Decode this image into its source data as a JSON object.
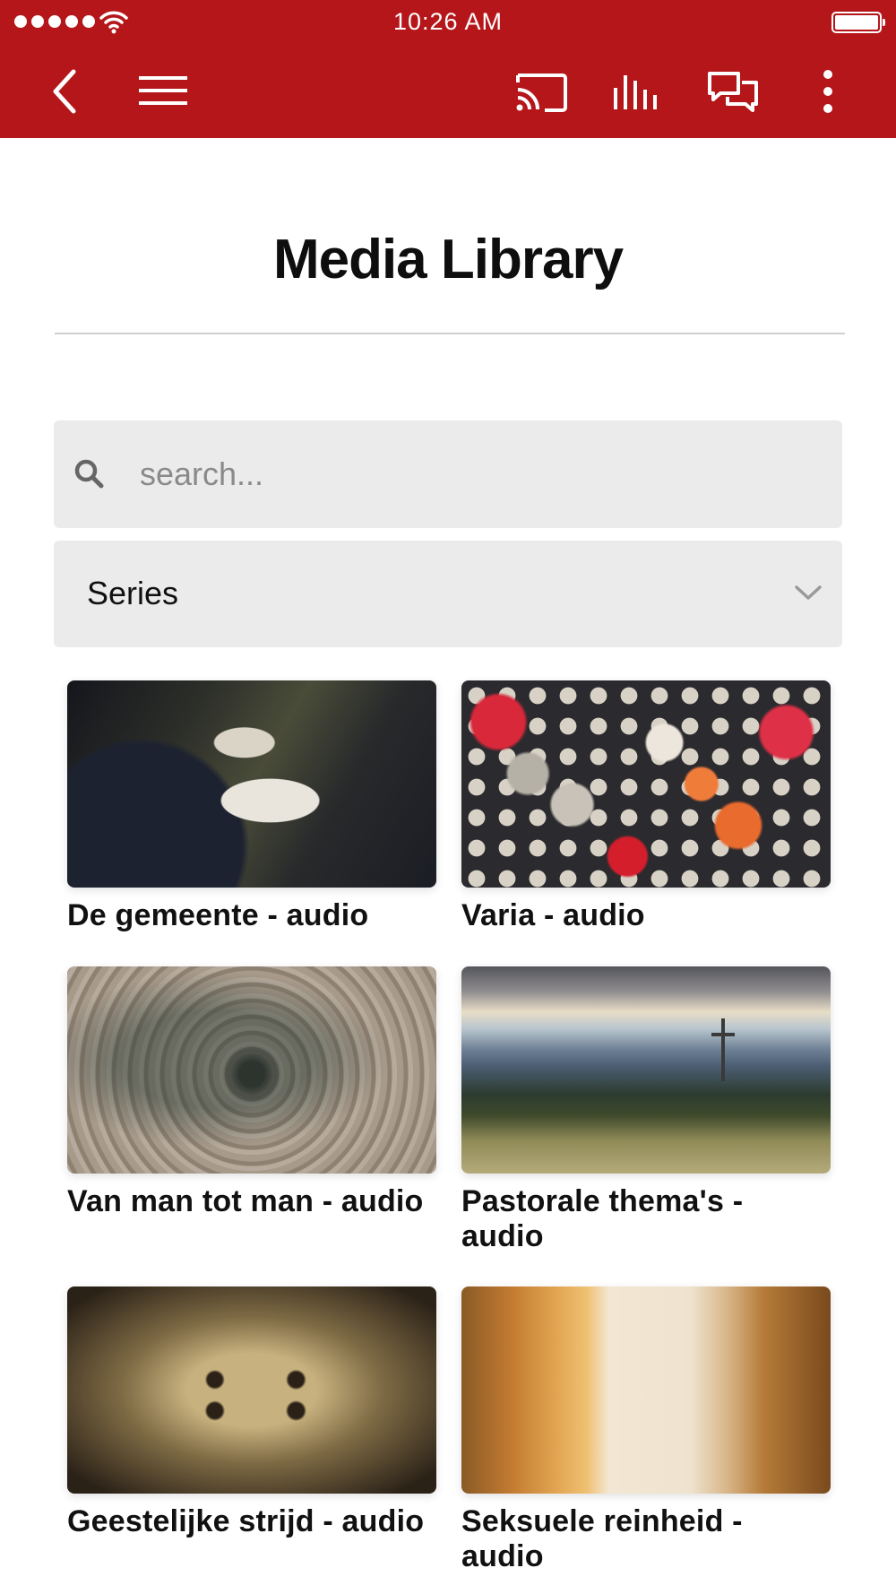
{
  "status_bar": {
    "time": "10:26 AM"
  },
  "nav": {
    "back_icon": "chevron-left-icon",
    "menu_icon": "hamburger-menu-icon",
    "cast_icon": "cast-icon",
    "audio_icon": "audio-bars-icon",
    "chat_icon": "chat-bubbles-icon",
    "more_icon": "more-vertical-icon"
  },
  "page": {
    "title": "Media Library"
  },
  "search": {
    "placeholder": "search...",
    "value": ""
  },
  "filter": {
    "selected": "Series"
  },
  "media_items": [
    {
      "title": "De gemeente - audio"
    },
    {
      "title": "Varia - audio"
    },
    {
      "title": "Van man tot man - audio"
    },
    {
      "title": "Pastorale thema's - audio"
    },
    {
      "title": "Geestelijke strijd - audio"
    },
    {
      "title": "Seksuele reinheid - audio"
    }
  ],
  "colors": {
    "accent": "#b5161a",
    "field_bg": "#ebebeb"
  }
}
